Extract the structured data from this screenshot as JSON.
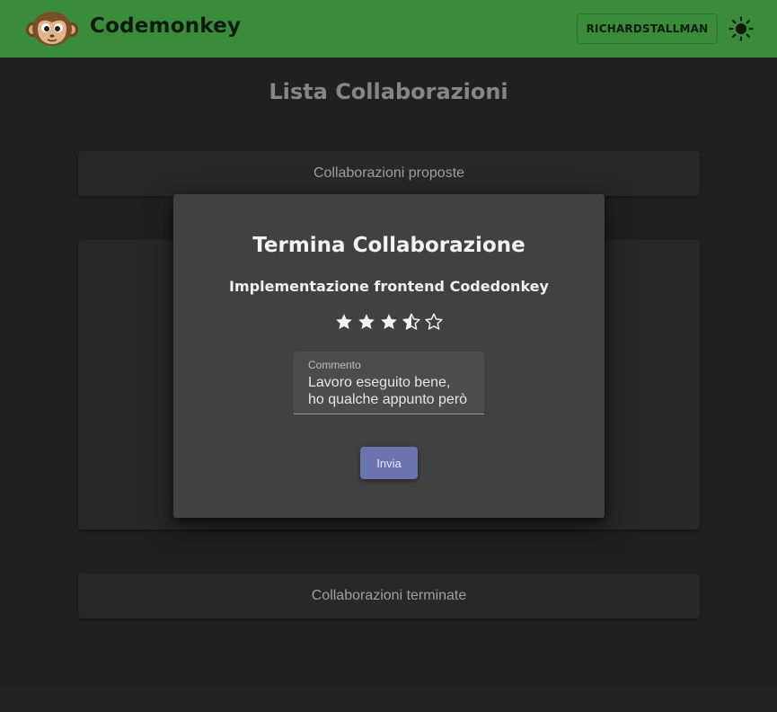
{
  "app": {
    "brand_name": "Codemonkey",
    "user_label": "RICHARDSTALLMAN",
    "logo_icon": "monkey-face-icon",
    "theme_icon": "sun-icon"
  },
  "page": {
    "title": "Lista Collaborazioni"
  },
  "sections": [
    {
      "label": "Collaborazioni proposte"
    },
    {
      "label": ""
    },
    {
      "label": "Collaborazioni terminate"
    }
  ],
  "dialog": {
    "title": "Termina Collaborazione",
    "project_name": "Implementazione frontend Codedonkey",
    "rating": {
      "value": 3.5,
      "max": 5
    },
    "comment": {
      "label": "Commento",
      "value": "Lavoro eseguito bene, ho qualche appunto però da fare"
    },
    "submit_label": "Invia"
  },
  "colors": {
    "header_bg": "#3a8c3a",
    "background": "#232323",
    "panel_bg": "#2b2b2b",
    "dialog_bg": "#414141",
    "primary_button": "#6c74b0"
  }
}
